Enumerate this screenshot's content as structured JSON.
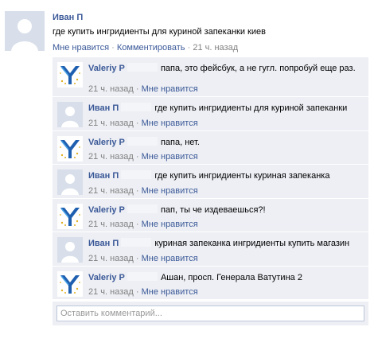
{
  "post": {
    "author": "Иван П",
    "text": "где купить ингридиенты для куриной запеканки киев",
    "actions": {
      "dislike": "Мне нравится",
      "separator": "·",
      "comment": "Комментировать",
      "time": "21 ч. назад"
    }
  },
  "comments": [
    {
      "author": "Valeriy P",
      "text": "папа, это фейсбук, а не гугл. попробуй еще раз.",
      "time": "21 ч. назад",
      "like": "Мне нравится",
      "avatar": "logo-y-icon"
    },
    {
      "author": "Иван П",
      "text": "где купить ингридиенты для куриной запеканки",
      "time": "21 ч. назад",
      "like": "Мне нравится",
      "avatar": "default-user-icon"
    },
    {
      "author": "Valeriy P",
      "text": "папа, нет.",
      "time": "21 ч. назад",
      "like": "Мне нравится",
      "avatar": "logo-y-icon"
    },
    {
      "author": "Иван П",
      "text": "где купить ингридиенты куриная запеканка",
      "time": "21 ч. назад",
      "like": "Мне нравится",
      "avatar": "default-user-icon"
    },
    {
      "author": "Valeriy P",
      "text": "пап, ты че издеваешься?!",
      "time": "21 ч. назад",
      "like": "Мне нравится",
      "avatar": "logo-y-icon"
    },
    {
      "author": "Иван П",
      "text": "куриная запеканка ингридиенты купить магазин",
      "time": "21 ч. назад",
      "like": "Мне нравится",
      "avatar": "default-user-icon"
    },
    {
      "author": "Valeriy P",
      "text": "Ашан, просп. Генерала Ватутина 2",
      "time": "21 ч. назад",
      "like": "Мне нравится",
      "avatar": "logo-y-icon"
    }
  ],
  "comment_input": {
    "placeholder": "Оставить комментарий..."
  },
  "colors": {
    "link": "#3b5998",
    "comment_bg": "#edeff4",
    "meta": "#808080"
  }
}
